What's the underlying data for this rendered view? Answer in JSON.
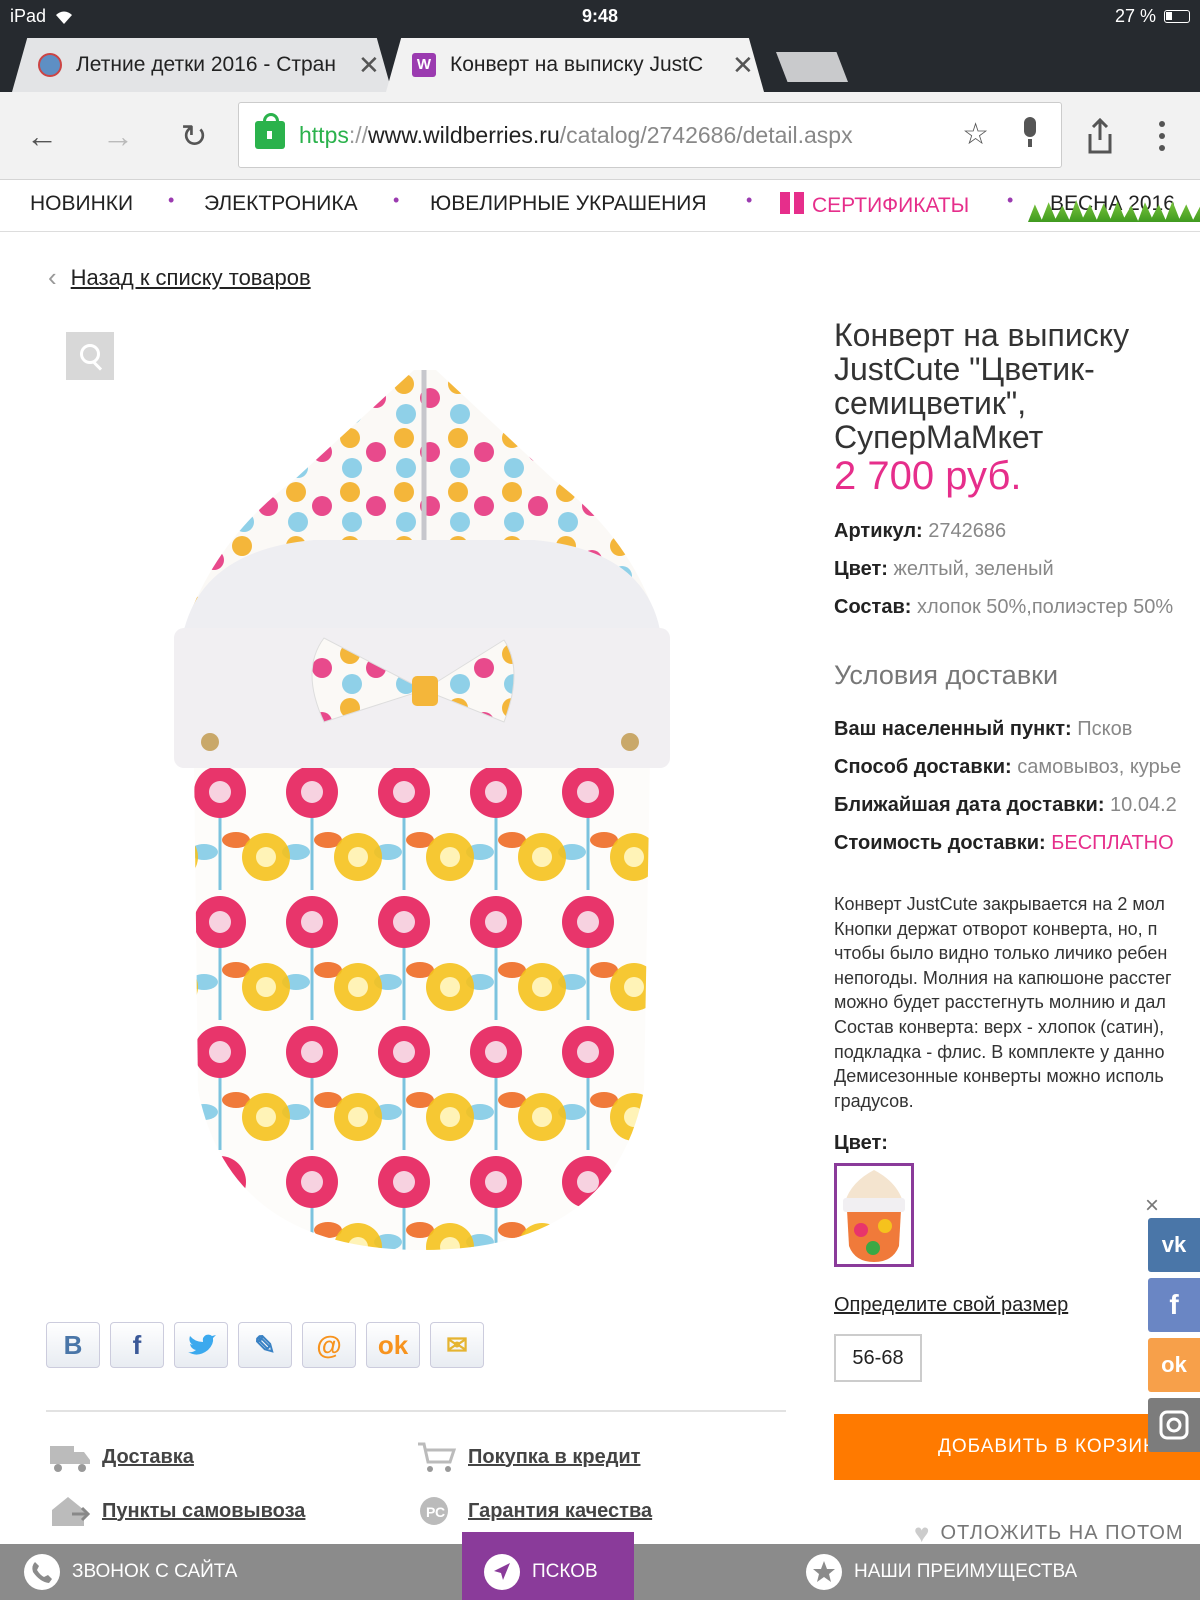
{
  "status_bar": {
    "device": "iPad",
    "time": "9:48",
    "battery": "27 %"
  },
  "tabs": [
    {
      "title": "Летние детки 2016 - Стран",
      "active": false
    },
    {
      "title": "Конверт на выписку JustC",
      "active": true
    }
  ],
  "url": {
    "scheme": "https",
    "sep": "://",
    "domain": "www.wildberries.ru",
    "path": "/catalog/2742686/detail.aspx"
  },
  "categories": [
    "НОВИНКИ",
    "ЭЛЕКТРОНИКА",
    "ЮВЕЛИРНЫЕ УКРАШЕНИЯ",
    "СЕРТИФИКАТЫ",
    "ВЕСНА 2016"
  ],
  "back_link": "Назад к списку товаров",
  "product": {
    "title_lines": [
      "Конверт на выписку",
      "JustCute \"Цветик-",
      "семицветик\",",
      "СуперМаМкет"
    ],
    "price": "2 700 руб.",
    "article_label": "Артикул:",
    "article_value": "2742686",
    "color_label": "Цвет:",
    "color_value": "желтый, зеленый",
    "composition_label": "Состав:",
    "composition_value": "хлопок 50%,полиэстер 50%"
  },
  "delivery": {
    "heading": "Условия доставки",
    "city_label": "Ваш населенный пункт:",
    "city_value": "Псков",
    "method_label": "Способ доставки:",
    "method_value": "самовывоз, курье",
    "date_label": "Ближайшая дата доставки:",
    "date_value": "10.04.2",
    "cost_label": "Стоимость доставки:",
    "cost_value": "БЕСПЛАТНО"
  },
  "description": [
    "Конверт JustCute закрывается на 2 мол",
    "Кнопки держат отворот конверта, но, п",
    "чтобы было видно только личико ребен",
    "непогоды. Молния на капюшоне расстег",
    "можно будет расстегнуть молнию и дал",
    "Состав конверта: верх - хлопок (сатин),",
    "подкладка - флис. В комплекте у данно",
    "Демисезонные конверты можно исполь",
    "градусов."
  ],
  "color_section_label": "Цвет:",
  "size_link": "Определите свой размер",
  "size_value": "56-68",
  "add_to_cart": "ДОБАВИТЬ В КОРЗИНУ",
  "save_later": "ОТЛОЖИТЬ НА ПОТОМ",
  "info_links": [
    "Доставка",
    "Покупка в кредит",
    "Пункты самовывоза",
    "Гарантия качества"
  ],
  "share_buttons": [
    "vkontakte",
    "facebook",
    "twitter",
    "livejournal",
    "mail",
    "odnoklassniki",
    "email"
  ],
  "bottom_bar": {
    "call": "ЗВОНОК С САЙТА",
    "city": "ПСКОВ",
    "advantages": "НАШИ ПРЕИМУЩЕСТВА"
  },
  "colors": {
    "accent_pink": "#e62e8b",
    "accent_purple": "#8a3b9a",
    "cart_orange": "#ff7a00",
    "ssl_green": "#2bb24c"
  }
}
